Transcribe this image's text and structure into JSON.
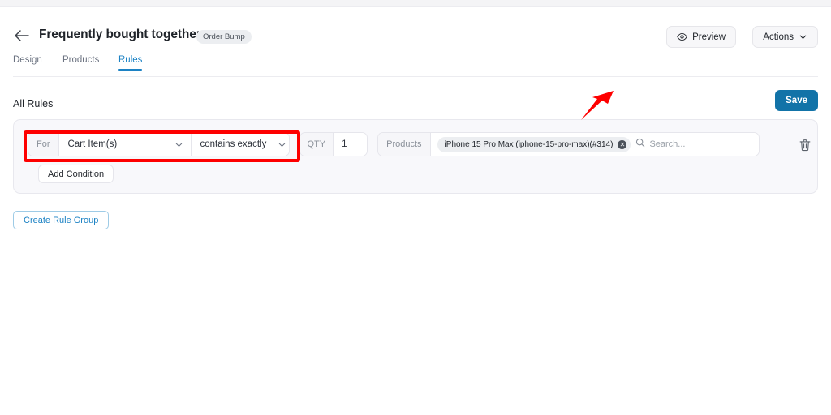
{
  "header": {
    "back_icon": "arrow-left-icon",
    "title": "Frequently bought together",
    "badge": "Order Bump",
    "preview_label": "Preview",
    "preview_icon": "eye-icon",
    "actions_label": "Actions",
    "actions_icon": "chevron-down-icon"
  },
  "tabs": [
    {
      "label": "Design",
      "active": false
    },
    {
      "label": "Products",
      "active": false
    },
    {
      "label": "Rules",
      "active": true
    }
  ],
  "main": {
    "section_title": "All Rules",
    "save_label": "Save",
    "create_rule_group_label": "Create Rule Group"
  },
  "rule": {
    "for_label": "For",
    "subject_value": "Cart Item(s)",
    "operator_value": "contains exactly",
    "qty_label": "QTY",
    "qty_value": "1",
    "products_label": "Products",
    "product_chip": "iPhone 15 Pro Max (iphone-15-pro-max)(#314)",
    "chip_remove_icon": "close-circle-icon",
    "search_icon": "search-icon",
    "search_placeholder": "Search...",
    "delete_icon": "trash-icon",
    "add_condition_label": "Add Condition",
    "dropdown_icon": "chevron-down-icon"
  },
  "annotations": {
    "highlight_color": "#fe0000",
    "arrow_color": "#fe0000",
    "highlight_target": "for-condition-controls",
    "arrow_points_to": "rule-row"
  },
  "colors": {
    "accent_blue": "#1c82c4",
    "save_blue": "#1273a8",
    "card_background": "#f8f8fb",
    "annotation_red": "#fe0000"
  }
}
